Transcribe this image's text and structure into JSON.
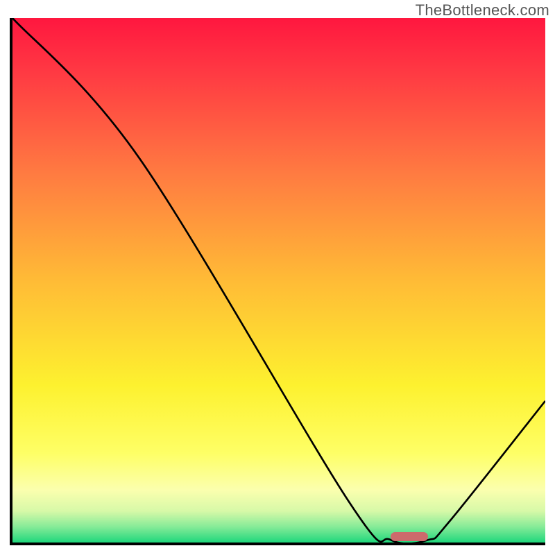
{
  "watermark": "TheBottleneck.com",
  "chart_data": {
    "type": "line",
    "title": "",
    "xlabel": "",
    "ylabel": "",
    "ylim": [
      0,
      100
    ],
    "xlim": [
      0,
      100
    ],
    "series": [
      {
        "name": "curve",
        "x": [
          0,
          24,
          63,
          71,
          78,
          82,
          100
        ],
        "values": [
          100,
          73,
          8,
          0.5,
          0.5,
          4,
          27
        ]
      }
    ],
    "optimum_marker": {
      "x_start": 71,
      "x_end": 78,
      "y": 0.5
    },
    "gradient_stops": [
      {
        "pos": 0,
        "color": "#ff173f"
      },
      {
        "pos": 10,
        "color": "#ff3843"
      },
      {
        "pos": 30,
        "color": "#ff7c41"
      },
      {
        "pos": 50,
        "color": "#ffbb36"
      },
      {
        "pos": 70,
        "color": "#fdf12f"
      },
      {
        "pos": 83,
        "color": "#feff66"
      },
      {
        "pos": 90,
        "color": "#fbffae"
      },
      {
        "pos": 94,
        "color": "#d7f9a8"
      },
      {
        "pos": 97,
        "color": "#86eb98"
      },
      {
        "pos": 100,
        "color": "#1fd77c"
      }
    ],
    "annotations": []
  }
}
